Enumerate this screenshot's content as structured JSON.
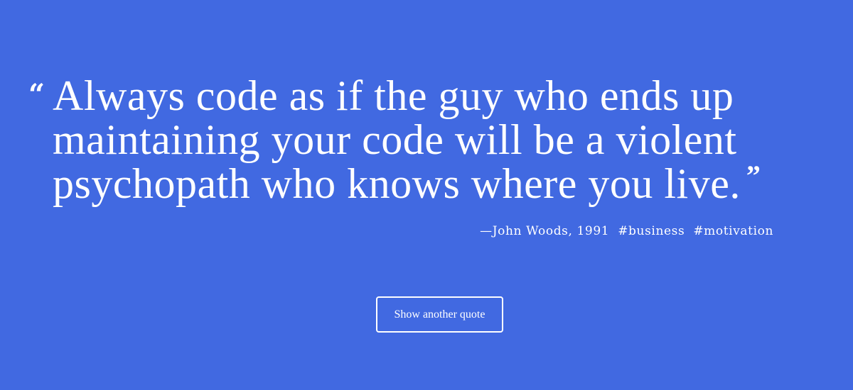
{
  "theme": {
    "background": "#4169E1",
    "text": "#ffffff"
  },
  "quote": {
    "open_mark": "“",
    "text": "Always code as if the guy who ends up maintaining your code will be a violent psychopath who knows where you live.",
    "close_mark": "”",
    "author": "—John Woods, 1991",
    "tags": [
      "#business",
      "#motivation"
    ]
  },
  "actions": {
    "show_another_label": "Show another quote"
  }
}
